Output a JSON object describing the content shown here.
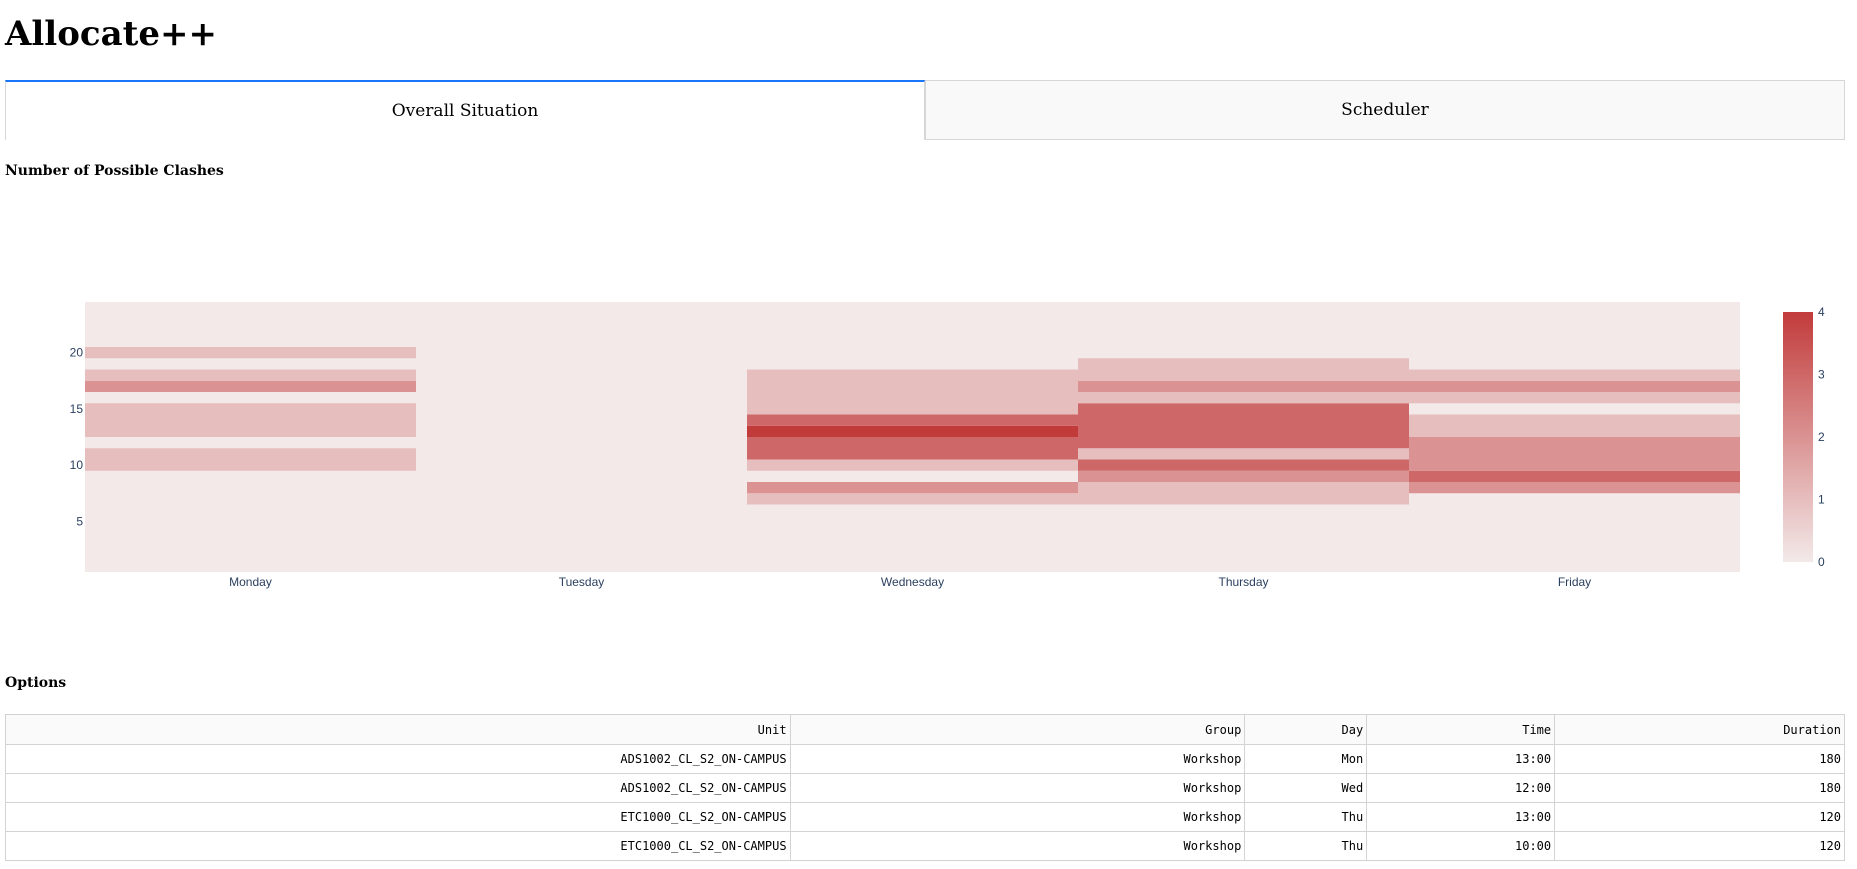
{
  "app": {
    "title": "Allocate++"
  },
  "tabs": [
    {
      "label": "Overall Situation",
      "active": true
    },
    {
      "label": "Scheduler",
      "active": false
    }
  ],
  "clashes_section": {
    "title": "Number of Possible Clashes"
  },
  "options_section": {
    "title": "Options"
  },
  "colors": {
    "tab_accent": "#1975FA",
    "scale_low": "#f3e9e9",
    "scale_high": "#c23b3b",
    "axis_text": "#2a3f5f"
  },
  "chart_data": {
    "type": "heatmap",
    "title": "",
    "xlabel": "",
    "ylabel": "",
    "x": [
      "Monday",
      "Tuesday",
      "Wednesday",
      "Thursday",
      "Friday"
    ],
    "y_range": [
      0.5,
      24.5
    ],
    "y_ticks": [
      5,
      10,
      15,
      20
    ],
    "y_tick_labels": [
      "5",
      "10",
      "15",
      "20"
    ],
    "colorscale_range": [
      0,
      4
    ],
    "colorbar_ticks": [
      0,
      1,
      2,
      3,
      4
    ],
    "colorbar_tick_labels": [
      "0",
      "1",
      "2",
      "3",
      "4"
    ],
    "cells": [
      {
        "day": "Monday",
        "y_from": 9.5,
        "y_to": 11.5,
        "value": 1
      },
      {
        "day": "Monday",
        "y_from": 12.5,
        "y_to": 15.5,
        "value": 1
      },
      {
        "day": "Monday",
        "y_from": 16.5,
        "y_to": 17.5,
        "value": 2
      },
      {
        "day": "Monday",
        "y_from": 17.5,
        "y_to": 18.5,
        "value": 1
      },
      {
        "day": "Monday",
        "y_from": 19.5,
        "y_to": 20.5,
        "value": 1
      },
      {
        "day": "Wednesday",
        "y_from": 6.5,
        "y_to": 7.5,
        "value": 1
      },
      {
        "day": "Wednesday",
        "y_from": 7.5,
        "y_to": 8.5,
        "value": 2
      },
      {
        "day": "Wednesday",
        "y_from": 9.5,
        "y_to": 10.5,
        "value": 1
      },
      {
        "day": "Wednesday",
        "y_from": 10.5,
        "y_to": 12.5,
        "value": 3
      },
      {
        "day": "Wednesday",
        "y_from": 12.5,
        "y_to": 13.5,
        "value": 4
      },
      {
        "day": "Wednesday",
        "y_from": 13.5,
        "y_to": 14.5,
        "value": 3
      },
      {
        "day": "Wednesday",
        "y_from": 14.5,
        "y_to": 18.5,
        "value": 1
      },
      {
        "day": "Thursday",
        "y_from": 6.5,
        "y_to": 8.5,
        "value": 1
      },
      {
        "day": "Thursday",
        "y_from": 8.5,
        "y_to": 9.5,
        "value": 2
      },
      {
        "day": "Thursday",
        "y_from": 9.5,
        "y_to": 10.5,
        "value": 3
      },
      {
        "day": "Thursday",
        "y_from": 10.5,
        "y_to": 11.5,
        "value": 1
      },
      {
        "day": "Thursday",
        "y_from": 11.5,
        "y_to": 15.5,
        "value": 3
      },
      {
        "day": "Thursday",
        "y_from": 15.5,
        "y_to": 16.5,
        "value": 1
      },
      {
        "day": "Thursday",
        "y_from": 16.5,
        "y_to": 17.5,
        "value": 2
      },
      {
        "day": "Thursday",
        "y_from": 17.5,
        "y_to": 19.5,
        "value": 1
      },
      {
        "day": "Friday",
        "y_from": 7.5,
        "y_to": 8.5,
        "value": 2
      },
      {
        "day": "Friday",
        "y_from": 8.5,
        "y_to": 9.5,
        "value": 3
      },
      {
        "day": "Friday",
        "y_from": 9.5,
        "y_to": 12.5,
        "value": 2
      },
      {
        "day": "Friday",
        "y_from": 12.5,
        "y_to": 14.5,
        "value": 1
      },
      {
        "day": "Friday",
        "y_from": 15.5,
        "y_to": 16.5,
        "value": 1
      },
      {
        "day": "Friday",
        "y_from": 16.5,
        "y_to": 17.5,
        "value": 2
      },
      {
        "day": "Friday",
        "y_from": 17.5,
        "y_to": 18.5,
        "value": 1
      }
    ]
  },
  "options_table": {
    "columns": [
      "Unit",
      "Group",
      "Day",
      "Time",
      "Duration"
    ],
    "rows": [
      [
        "ADS1002_CL_S2_ON-CAMPUS",
        "Workshop",
        "Mon",
        "13:00",
        "180"
      ],
      [
        "ADS1002_CL_S2_ON-CAMPUS",
        "Workshop",
        "Wed",
        "12:00",
        "180"
      ],
      [
        "ETC1000_CL_S2_ON-CAMPUS",
        "Workshop",
        "Thu",
        "13:00",
        "120"
      ],
      [
        "ETC1000_CL_S2_ON-CAMPUS",
        "Workshop",
        "Thu",
        "10:00",
        "120"
      ]
    ]
  }
}
